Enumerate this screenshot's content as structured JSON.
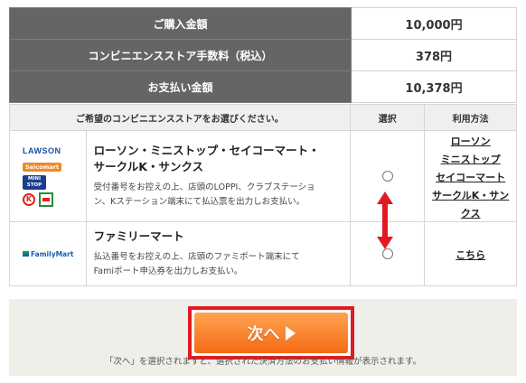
{
  "summary": {
    "purchase_label": "ご購入金額",
    "purchase_value": "10,000円",
    "fee_label": "コンビニエンスストア手数料（税込）",
    "fee_value": "378円",
    "total_label": "お支払い金額",
    "total_value": "10,378円"
  },
  "stores": {
    "header_store": "ご希望のコンビニエンスストアをお選びください。",
    "header_select": "選択",
    "header_method": "利用方法",
    "rows": [
      {
        "logos": {
          "lawson": "LAWSON",
          "seico": "Seicomart",
          "ministop_1": "MINI",
          "ministop_2": "STOP",
          "circlek": "K"
        },
        "name_line1": "ローソン・ミニストップ・セイコーマート・",
        "name_line2": "サークルK・サンクス",
        "desc_line1": "受付番号をお控えの上、店頭のLOPPI、クラブステーショ",
        "desc_line2": "ン、Kステーション端末にて払込票を出力しお支払い。",
        "method_line1": "ローソン",
        "method_line2": "ミニストップ",
        "method_line3": "セイコーマート",
        "method_line4": "サークルK・サン",
        "method_line5": "クス"
      },
      {
        "logos": {
          "familymart": "FamilyMart"
        },
        "name_line1": "ファミリーマート",
        "desc_line1": "払込番号をお控えの上、店頭のファミポート端末にて",
        "desc_line2": "Famiポート申込券を出力しお支払い。",
        "method_line1": "こちら"
      }
    ]
  },
  "footer": {
    "next_label": "次へ",
    "note": "「次へ」を選択されますと、選択された決済方法のお支払い情報が表示されます。"
  },
  "colors": {
    "header_bg": "#656565",
    "button_orange": "#f46a13",
    "highlight_red": "#e21b22"
  }
}
